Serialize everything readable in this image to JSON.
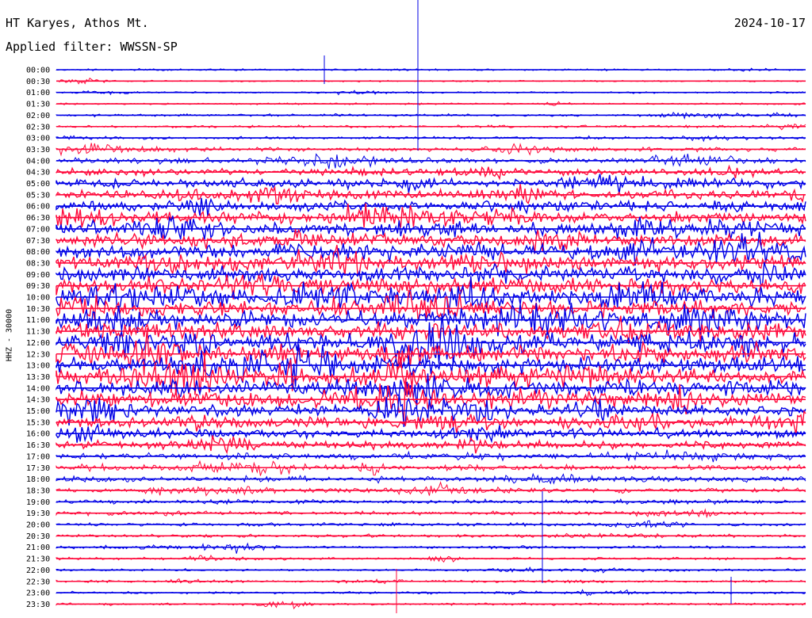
{
  "header": {
    "station": "HT Karyes, Athos Mt.",
    "filter": "Applied filter: WWSSN-SP",
    "date": "2024-10-17"
  },
  "chart_data": {
    "type": "line",
    "ylabel": "HHZ - 30000",
    "rows": [
      "00:00",
      "00:30",
      "01:00",
      "01:30",
      "02:00",
      "02:30",
      "03:00",
      "03:30",
      "04:00",
      "04:30",
      "05:00",
      "05:30",
      "06:00",
      "06:30",
      "07:00",
      "07:30",
      "08:00",
      "08:30",
      "09:00",
      "09:30",
      "10:00",
      "10:30",
      "11:00",
      "11:30",
      "12:00",
      "12:30",
      "13:00",
      "13:30",
      "14:00",
      "14:30",
      "15:00",
      "15:30",
      "16:00",
      "16:30",
      "17:00",
      "17:30",
      "18:00",
      "18:30",
      "19:00",
      "19:30",
      "20:00",
      "20:30",
      "21:00",
      "21:30",
      "22:00",
      "22:30",
      "23:00",
      "23:30"
    ],
    "colors": [
      "#0000e6",
      "#ff0a3c"
    ],
    "noise_level": [
      0.4,
      0.3,
      0.4,
      0.5,
      0.8,
      0.9,
      1.0,
      1.6,
      2.5,
      3.3,
      4.0,
      4.5,
      5.0,
      5.5,
      6.0,
      6.6,
      7.2,
      7.5,
      7.8,
      8.0,
      8.2,
      8.4,
      8.5,
      8.5,
      8.6,
      8.6,
      8.5,
      8.4,
      8.0,
      7.5,
      6.5,
      5.5,
      4.2,
      3.3,
      3.0,
      2.6,
      2.6,
      2.2,
      1.8,
      1.5,
      1.3,
      1.2,
      1.0,
      0.9,
      0.8,
      0.8,
      0.7,
      0.7
    ]
  }
}
